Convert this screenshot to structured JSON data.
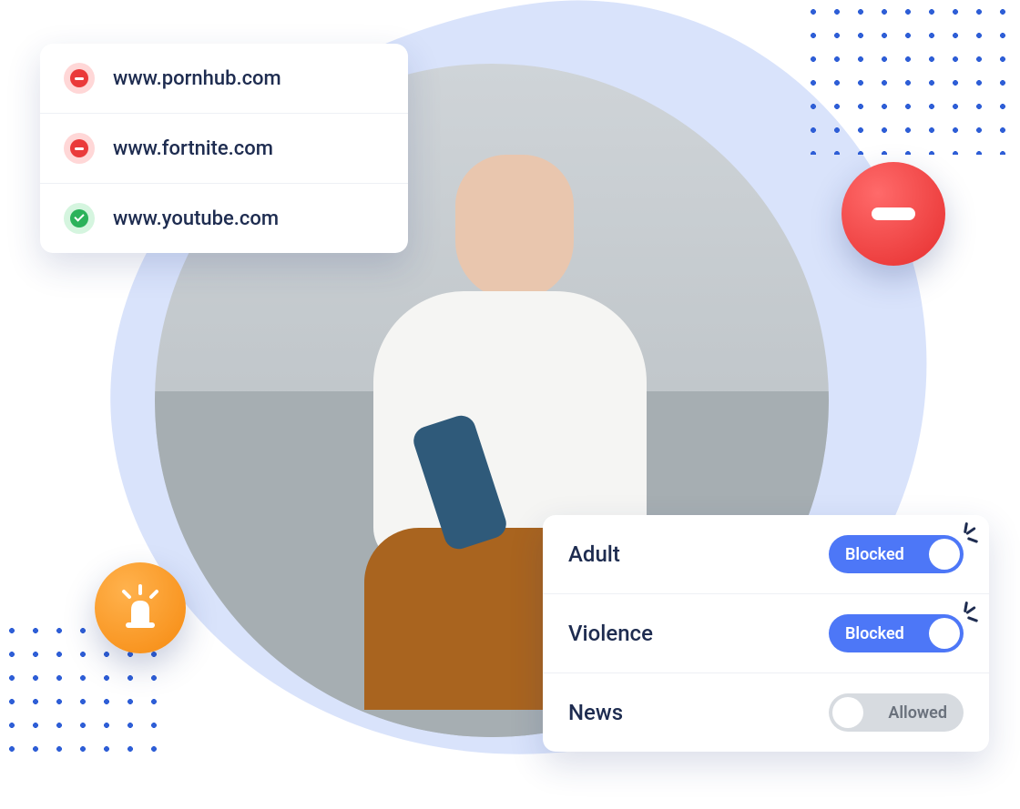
{
  "sites": [
    {
      "url": "www.pornhub.com",
      "status": "blocked"
    },
    {
      "url": "www.fortnite.com",
      "status": "blocked"
    },
    {
      "url": "www.youtube.com",
      "status": "allowed"
    }
  ],
  "categories": [
    {
      "name": "Adult",
      "state": "Blocked",
      "on": true
    },
    {
      "name": "Violence",
      "state": "Blocked",
      "on": true
    },
    {
      "name": "News",
      "state": "Allowed",
      "on": false
    }
  ],
  "icons": {
    "block": "block-icon",
    "allow": "check-icon",
    "alert": "siren-icon"
  }
}
